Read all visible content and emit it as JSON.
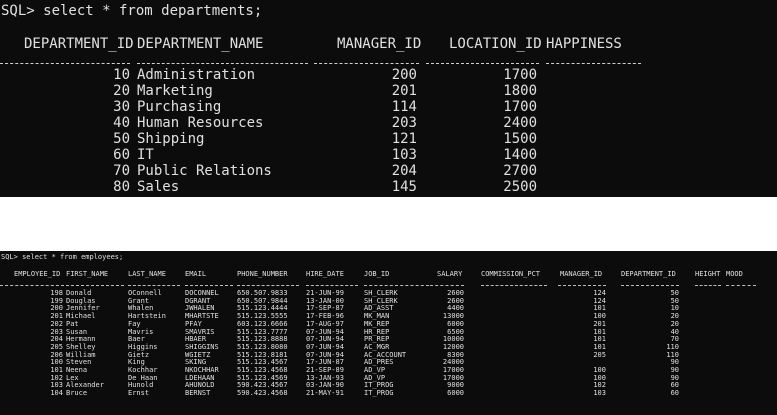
{
  "departments_panel": {
    "prompt": "SQL> select * from departments;",
    "columns": [
      "DEPARTMENT_ID",
      "DEPARTMENT_NAME",
      "MANAGER_ID",
      "LOCATION_ID",
      "HAPPINESS"
    ],
    "rows": [
      {
        "id": "10",
        "name": "Administration",
        "manager": "200",
        "location": "1700",
        "happiness": ""
      },
      {
        "id": "20",
        "name": "Marketing",
        "manager": "201",
        "location": "1800",
        "happiness": ""
      },
      {
        "id": "30",
        "name": "Purchasing",
        "manager": "114",
        "location": "1700",
        "happiness": ""
      },
      {
        "id": "40",
        "name": "Human Resources",
        "manager": "203",
        "location": "2400",
        "happiness": ""
      },
      {
        "id": "50",
        "name": "Shipping",
        "manager": "121",
        "location": "1500",
        "happiness": ""
      },
      {
        "id": "60",
        "name": "IT",
        "manager": "103",
        "location": "1400",
        "happiness": ""
      },
      {
        "id": "70",
        "name": "Public Relations",
        "manager": "204",
        "location": "2700",
        "happiness": ""
      },
      {
        "id": "80",
        "name": "Sales",
        "manager": "145",
        "location": "2500",
        "happiness": ""
      }
    ]
  },
  "employees_panel": {
    "prompt": "SQL> select * from employees;",
    "columns": [
      "EMPLOYEE_ID",
      "FIRST_NAME",
      "LAST_NAME",
      "EMAIL",
      "PHONE_NUMBER",
      "HIRE_DATE",
      "JOB_ID",
      "SALARY",
      "COMMISSION_PCT",
      "MANAGER_ID",
      "DEPARTMENT_ID",
      "HEIGHT",
      "MOOD"
    ],
    "rows": [
      [
        "198",
        "Donald",
        "OConnell",
        "DOCONNEL",
        "650.507.9833",
        "21-JUN-99",
        "SH_CLERK",
        "2600",
        "",
        "124",
        "50",
        "",
        ""
      ],
      [
        "199",
        "Douglas",
        "Grant",
        "DGRANT",
        "650.507.9844",
        "13-JAN-00",
        "SH_CLERK",
        "2600",
        "",
        "124",
        "50",
        "",
        ""
      ],
      [
        "200",
        "Jennifer",
        "Whalen",
        "JWHALEN",
        "515.123.4444",
        "17-SEP-87",
        "AD_ASST",
        "4400",
        "",
        "101",
        "10",
        "",
        ""
      ],
      [
        "201",
        "Michael",
        "Hartstein",
        "MHARTSTE",
        "515.123.5555",
        "17-FEB-96",
        "MK_MAN",
        "13000",
        "",
        "100",
        "20",
        "",
        ""
      ],
      [
        "202",
        "Pat",
        "Fay",
        "PFAY",
        "603.123.6666",
        "17-AUG-97",
        "MK_REP",
        "6000",
        "",
        "201",
        "20",
        "",
        ""
      ],
      [
        "203",
        "Susan",
        "Mavris",
        "SMAVRIS",
        "515.123.7777",
        "07-JUN-94",
        "HR_REP",
        "6500",
        "",
        "101",
        "40",
        "",
        ""
      ],
      [
        "204",
        "Hermann",
        "Baer",
        "HBAER",
        "515.123.8888",
        "07-JUN-94",
        "PR_REP",
        "10000",
        "",
        "101",
        "70",
        "",
        ""
      ],
      [
        "205",
        "Shelley",
        "Higgins",
        "SHIGGINS",
        "515.123.8080",
        "07-JUN-94",
        "AC_MGR",
        "12000",
        "",
        "101",
        "110",
        "",
        ""
      ],
      [
        "206",
        "William",
        "Gietz",
        "WGIETZ",
        "515.123.8181",
        "07-JUN-94",
        "AC_ACCOUNT",
        "8300",
        "",
        "205",
        "110",
        "",
        ""
      ],
      [
        "100",
        "Steven",
        "King",
        "SKING",
        "515.123.4567",
        "17-JUN-87",
        "AD_PRES",
        "24000",
        "",
        "",
        "90",
        "",
        ""
      ],
      [
        "101",
        "Neena",
        "Kochhar",
        "NKOCHHAR",
        "515.123.4568",
        "21-SEP-89",
        "AD_VP",
        "17000",
        "",
        "100",
        "90",
        "",
        ""
      ],
      [
        "102",
        "Lex",
        "De Haan",
        "LDEHAAN",
        "515.123.4569",
        "13-JAN-93",
        "AD_VP",
        "17000",
        "",
        "100",
        "90",
        "",
        ""
      ],
      [
        "103",
        "Alexander",
        "Hunold",
        "AHUNOLD",
        "590.423.4567",
        "03-JAN-90",
        "IT_PROG",
        "9000",
        "",
        "102",
        "60",
        "",
        ""
      ],
      [
        "104",
        "Bruce",
        "Ernst",
        "BERNST",
        "590.423.4568",
        "21-MAY-91",
        "IT_PROG",
        "6000",
        "",
        "103",
        "60",
        "",
        ""
      ]
    ]
  }
}
